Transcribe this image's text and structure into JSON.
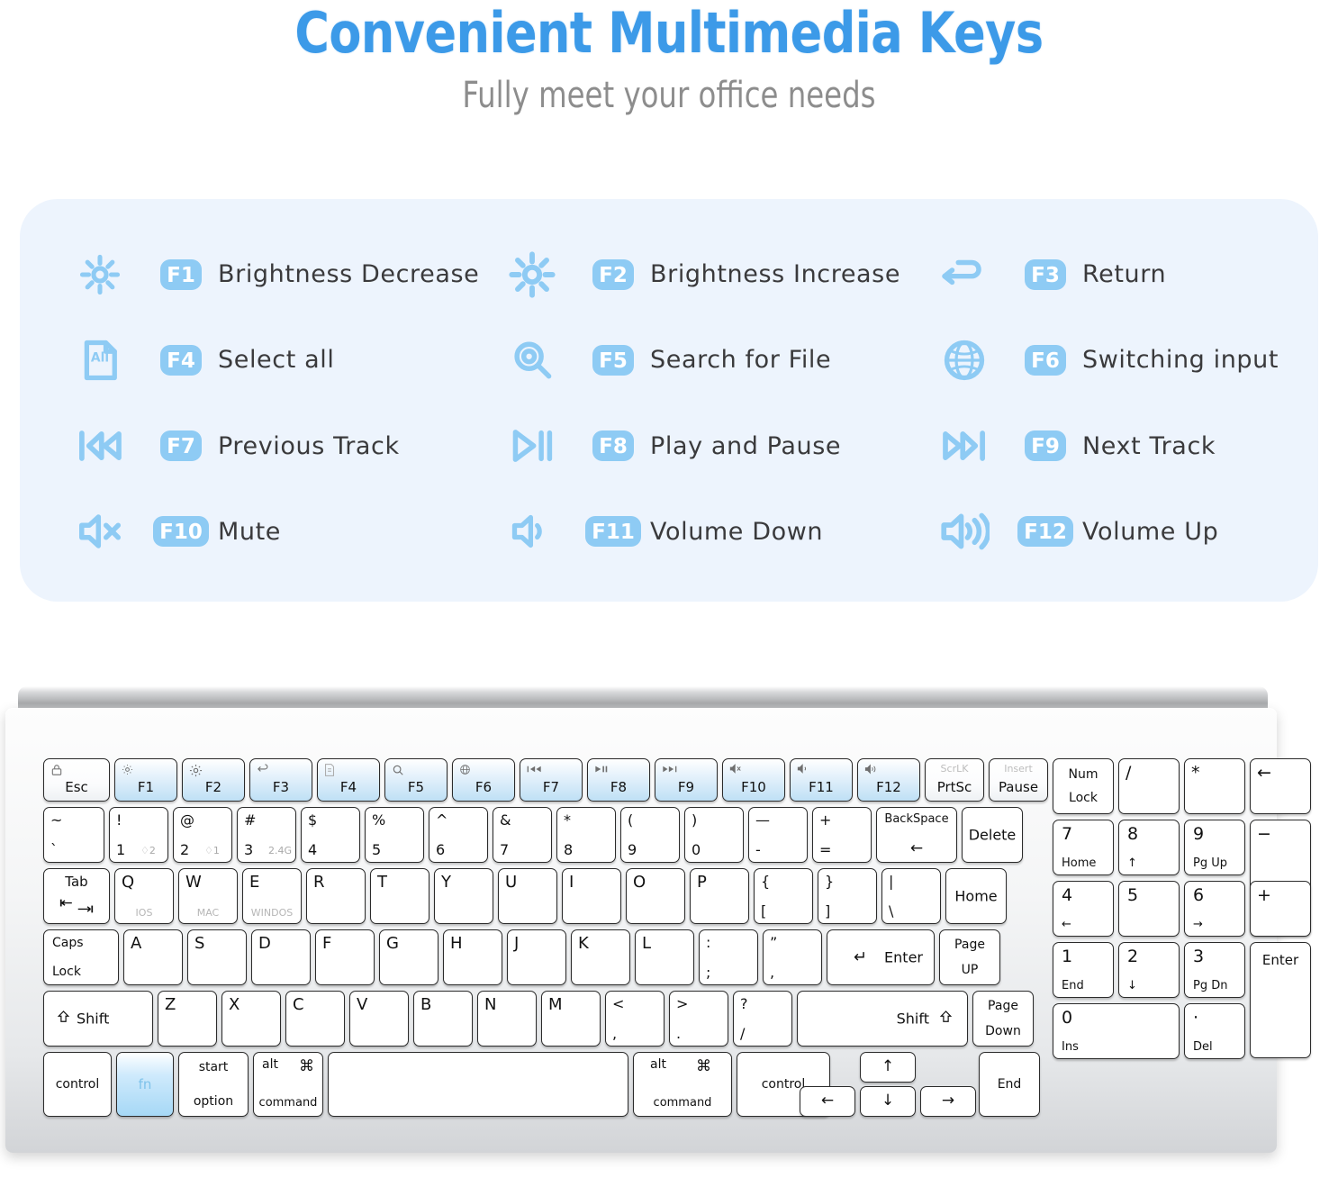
{
  "header": {
    "title": "Convenient Multimedia Keys",
    "subtitle": "Fully meet your office needs",
    "title_color": "#3c9ae8",
    "subtitle_color": "#8d8d8d"
  },
  "feature_card": {
    "background_color": "#edf4fd",
    "accent_color": "#8ecbf4",
    "label_color": "#3a3a3c",
    "features": [
      {
        "icon": "brightness-decrease-icon",
        "key": "F1",
        "label": "Brightness Decrease"
      },
      {
        "icon": "brightness-increase-icon",
        "key": "F2",
        "label": "Brightness Increase"
      },
      {
        "icon": "return-icon",
        "key": "F3",
        "label": "Return"
      },
      {
        "icon": "select-all-icon",
        "key": "F4",
        "label": "Select all"
      },
      {
        "icon": "search-file-icon",
        "key": "F5",
        "label": "Search for File"
      },
      {
        "icon": "globe-icon",
        "key": "F6",
        "label": "Switching input"
      },
      {
        "icon": "previous-track-icon",
        "key": "F7",
        "label": "Previous Track"
      },
      {
        "icon": "play-pause-icon",
        "key": "F8",
        "label": "Play and Pause"
      },
      {
        "icon": "next-track-icon",
        "key": "F9",
        "label": "Next Track"
      },
      {
        "icon": "mute-icon",
        "key": "F10",
        "label": "Mute"
      },
      {
        "icon": "volume-down-icon",
        "key": "F11",
        "label": "Volume Down"
      },
      {
        "icon": "volume-up-icon",
        "key": "F12",
        "label": "Volume Up"
      }
    ]
  },
  "keyboard": {
    "fn_highlight_key": "fn",
    "function_row": {
      "esc": {
        "label": "Esc",
        "icon": "lock-icon"
      },
      "keys": [
        {
          "label": "F1",
          "icon": "brightness-low-icon"
        },
        {
          "label": "F2",
          "icon": "brightness-high-icon"
        },
        {
          "label": "F3",
          "icon": "return-arrow-icon"
        },
        {
          "label": "F4",
          "icon": "select-all-small-icon"
        },
        {
          "label": "F5",
          "icon": "search-small-icon"
        },
        {
          "label": "F6",
          "icon": "globe-small-icon"
        },
        {
          "label": "F7",
          "icon": "prev-track-small-icon"
        },
        {
          "label": "F8",
          "icon": "play-pause-small-icon"
        },
        {
          "label": "F9",
          "icon": "next-track-small-icon"
        },
        {
          "label": "F10",
          "icon": "mute-small-icon"
        },
        {
          "label": "F11",
          "icon": "volume-down-small-icon"
        },
        {
          "label": "F12",
          "icon": "volume-up-small-icon"
        }
      ],
      "prtsc": {
        "top": "ScrLK",
        "label": "PrtSc"
      },
      "pause": {
        "top": "Insert",
        "label": "Pause"
      }
    },
    "number_row": [
      {
        "top": "~",
        "bottom": "`"
      },
      {
        "top": "!",
        "bottom": "1",
        "sub": "♢2"
      },
      {
        "top": "@",
        "bottom": "2",
        "sub": "♢1"
      },
      {
        "top": "#",
        "bottom": "3",
        "sub": "2.4G"
      },
      {
        "top": "$",
        "bottom": "4"
      },
      {
        "top": "%",
        "bottom": "5"
      },
      {
        "top": "^",
        "bottom": "6"
      },
      {
        "top": "&",
        "bottom": "7"
      },
      {
        "top": "*",
        "bottom": "8"
      },
      {
        "top": "(",
        "bottom": "9"
      },
      {
        "top": ")",
        "bottom": "0"
      },
      {
        "top": "—",
        "bottom": "-"
      },
      {
        "top": "+",
        "bottom": "="
      }
    ],
    "backspace": {
      "label": "BackSpace",
      "arrow": "←"
    },
    "delete": "Delete",
    "qwerty_row": {
      "tab": {
        "label": "Tab",
        "icon": "tab-arrows-icon"
      },
      "keys": [
        {
          "label": "Q",
          "sub": "IOS"
        },
        {
          "label": "W",
          "sub": "MAC"
        },
        {
          "label": "E",
          "sub": "WINDOS"
        },
        {
          "label": "R"
        },
        {
          "label": "T"
        },
        {
          "label": "Y"
        },
        {
          "label": "U"
        },
        {
          "label": "I"
        },
        {
          "label": "O"
        },
        {
          "label": "P"
        }
      ],
      "brackets": [
        {
          "top": "{",
          "bottom": "["
        },
        {
          "top": "}",
          "bottom": "]"
        },
        {
          "top": "|",
          "bottom": "\\"
        }
      ],
      "home": "Home"
    },
    "asdf_row": {
      "caps": {
        "line1": "Caps",
        "line2": "Lock"
      },
      "keys": [
        "A",
        "S",
        "D",
        "F",
        "G",
        "H",
        "J",
        "K",
        "L"
      ],
      "punct": [
        {
          "top": ":",
          "bottom": ";"
        },
        {
          "top": "”",
          "bottom": ","
        }
      ],
      "enter": {
        "arrow": "↵",
        "label": "Enter"
      },
      "page_up": {
        "line1": "Page",
        "line2": "UP"
      }
    },
    "zxcv_row": {
      "shift_left": {
        "icon": "shift-arrow-icon",
        "label": "Shift"
      },
      "keys": [
        "Z",
        "X",
        "C",
        "V",
        "B",
        "N",
        "M"
      ],
      "punct": [
        {
          "top": "<",
          "bottom": ","
        },
        {
          "top": ">",
          "bottom": "."
        },
        {
          "top": "?",
          "bottom": "/"
        }
      ],
      "shift_right": {
        "label": "Shift",
        "icon": "shift-arrow-icon"
      },
      "page_down": {
        "line1": "Page",
        "line2": "Down"
      }
    },
    "bottom_row": {
      "control_left": "control",
      "fn": "fn",
      "start_option": {
        "top": "start",
        "bottom": "option"
      },
      "alt_command_left": {
        "top_left": "alt",
        "top_right": "⌘",
        "bottom": "command"
      },
      "space": "",
      "alt_command_right": {
        "top_left": "alt",
        "top_right": "⌘",
        "bottom": "command"
      },
      "control_right": "control",
      "arrows": {
        "up": "↑",
        "left": "←",
        "down": "↓",
        "right": "→"
      },
      "end": "End"
    },
    "numpad": {
      "row1": [
        {
          "line1": "Num",
          "line2": "Lock"
        },
        {
          "label": "/"
        },
        {
          "label": "*"
        },
        {
          "label": "←"
        }
      ],
      "row2": [
        {
          "num": "7",
          "sub": "Home"
        },
        {
          "num": "8",
          "sub": "↑"
        },
        {
          "num": "9",
          "sub": "Pg Up"
        },
        {
          "label": "−"
        }
      ],
      "row3": [
        {
          "num": "4",
          "sub": "←"
        },
        {
          "num": "5",
          "sub": ""
        },
        {
          "num": "6",
          "sub": "→"
        },
        {
          "label": "+"
        }
      ],
      "row4": [
        {
          "num": "1",
          "sub": "End"
        },
        {
          "num": "2",
          "sub": "↓"
        },
        {
          "num": "3",
          "sub": "Pg Dn"
        },
        {
          "label": "Enter"
        }
      ],
      "row5": [
        {
          "num": "0",
          "sub": "Ins"
        },
        {
          "num": "·",
          "sub": "Del"
        }
      ]
    }
  }
}
